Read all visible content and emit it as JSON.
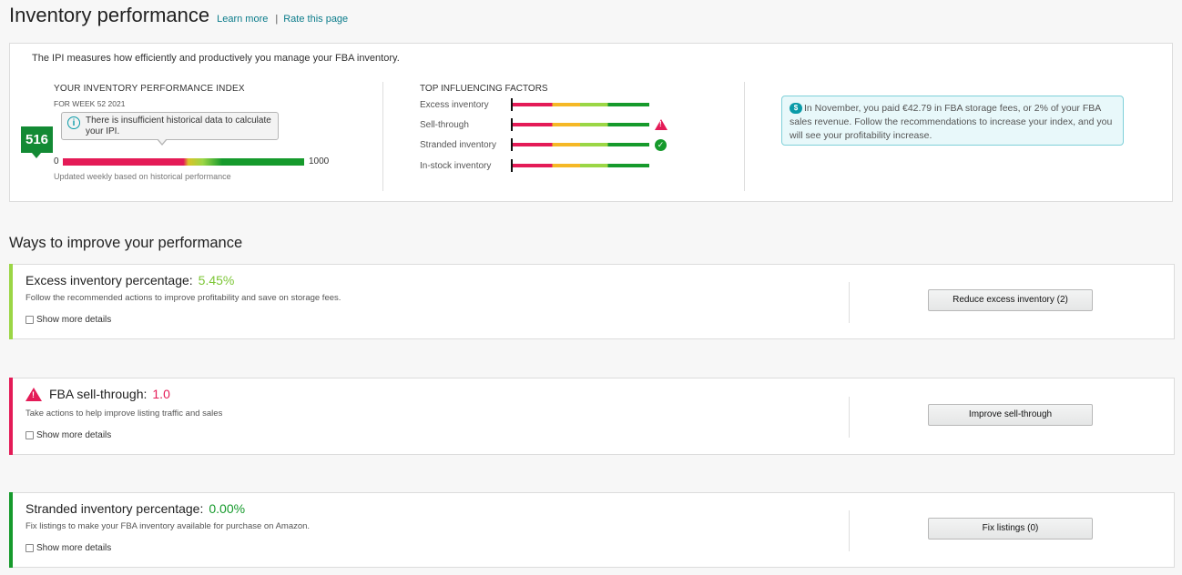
{
  "header": {
    "title": "Inventory performance",
    "learn_more": "Learn more",
    "separator": "|",
    "rate_page": "Rate this page"
  },
  "ipi": {
    "intro": "The IPI measures how efficiently and productively you manage your FBA inventory.",
    "section_title": "YOUR INVENTORY PERFORMANCE INDEX",
    "week": "FOR WEEK 52 2021",
    "tooltip": "There is insufficient historical data to calculate your IPI.",
    "score": "516",
    "min": "0",
    "max": "1000",
    "updated": "Updated weekly based on historical performance"
  },
  "factors": {
    "title": "TOP INFLUENCING FACTORS",
    "items": [
      {
        "label": "Excess inventory",
        "status_icon": ""
      },
      {
        "label": "Sell-through",
        "status_icon": "warning-icon"
      },
      {
        "label": "Stranded inventory",
        "status_icon": "check-icon"
      },
      {
        "label": "In-stock inventory",
        "status_icon": ""
      }
    ]
  },
  "fee_notice": {
    "text": "In November, you paid €42.79 in FBA storage fees, or 2% of your FBA sales revenue. Follow the recommendations to increase your index, and you will see your profitability increase."
  },
  "improve": {
    "title": "Ways to improve your performance",
    "cards": [
      {
        "title": "Excess inventory percentage:",
        "value": "5.45%",
        "value_color": "#7dc637",
        "accent": "#9bd645",
        "description": "Follow the recommended actions to improve profitability and save on storage fees.",
        "show_more": "Show more details",
        "button": "Reduce excess inventory (2)"
      },
      {
        "title": "FBA sell-through:",
        "value": "1.0",
        "value_color": "#e41b57",
        "accent": "#e41b57",
        "description": "Take actions to help improve listing traffic and sales",
        "show_more": "Show more details",
        "button": "Improve sell-through"
      },
      {
        "title": "Stranded inventory percentage:",
        "value": "0.00%",
        "value_color": "#169a2c",
        "accent": "#169a2c",
        "description": "Fix listings to make your FBA inventory available for purchase on Amazon.",
        "show_more": "Show more details",
        "button": "Fix listings (0)"
      }
    ]
  },
  "colors": {
    "link": "#0a7b8a",
    "score_badge": "#138a34"
  }
}
